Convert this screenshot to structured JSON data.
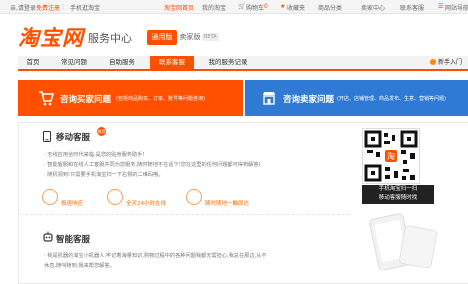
{
  "topbar": {
    "greeting": "亲,请登录",
    "free_signup": "免费注册",
    "mobile": "手机逛淘宝",
    "home": "淘宝网首页",
    "my_taobao": "我的淘宝",
    "cart": "购物车",
    "cart_count": "0",
    "favorites": "收藏夹",
    "categories": "商品分类",
    "seller_center": "卖家中心",
    "contact": "联系客服",
    "sitemap": "网站导航"
  },
  "header": {
    "logo_text": "淘宝网",
    "subtitle": "服务中心",
    "version_active": "通用版",
    "version_other": "卖家版",
    "beta": "BETA"
  },
  "nav": {
    "tabs": [
      {
        "label": "首页",
        "active": false
      },
      {
        "label": "常见问题",
        "active": false
      },
      {
        "label": "自助服务",
        "active": false
      },
      {
        "label": "联系客服",
        "active": true
      },
      {
        "label": "我的服务记录",
        "active": false
      }
    ],
    "help": "新手入门"
  },
  "banners": {
    "buyer_title": "咨询买家问题",
    "buyer_sub": "(包括商品购买、订单、账号等问题咨询)",
    "seller_title": "咨询卖家问题",
    "seller_sub": "(开店、店铺管理、商品发布、生意、营销等问题)"
  },
  "mobile_service": {
    "title": "移动客服",
    "badge": "推荐",
    "bullets": [
      "· 无线应用全时代来临,是您的贴身服务助手!",
      "· 智能客服和在线人工客服共同为您服务,随时随地不在话下!您在这里的任何问题都可得到解答!",
      "· 随机领到!只需要手机淘宝扫一下右侧的二维码哦。"
    ],
    "features": [
      "极速响应",
      "全天24小时在线",
      "随时随地一触即达"
    ],
    "qr_caption_line1": "手机淘宝扫一扫",
    "qr_caption_line2": "移动客服随时找"
  },
  "smart_service": {
    "title": "智能客服",
    "bullets": [
      "· 我是机器的淘宝小机器人,牢记着海量知识,购物过程中的各种问题我都无需担心,我总在那边,从不",
      "  休息,随叫随到,我来帮您解答。"
    ]
  },
  "colors": {
    "brand": "#ff5000",
    "seller_blue": "#2e7ad4"
  }
}
